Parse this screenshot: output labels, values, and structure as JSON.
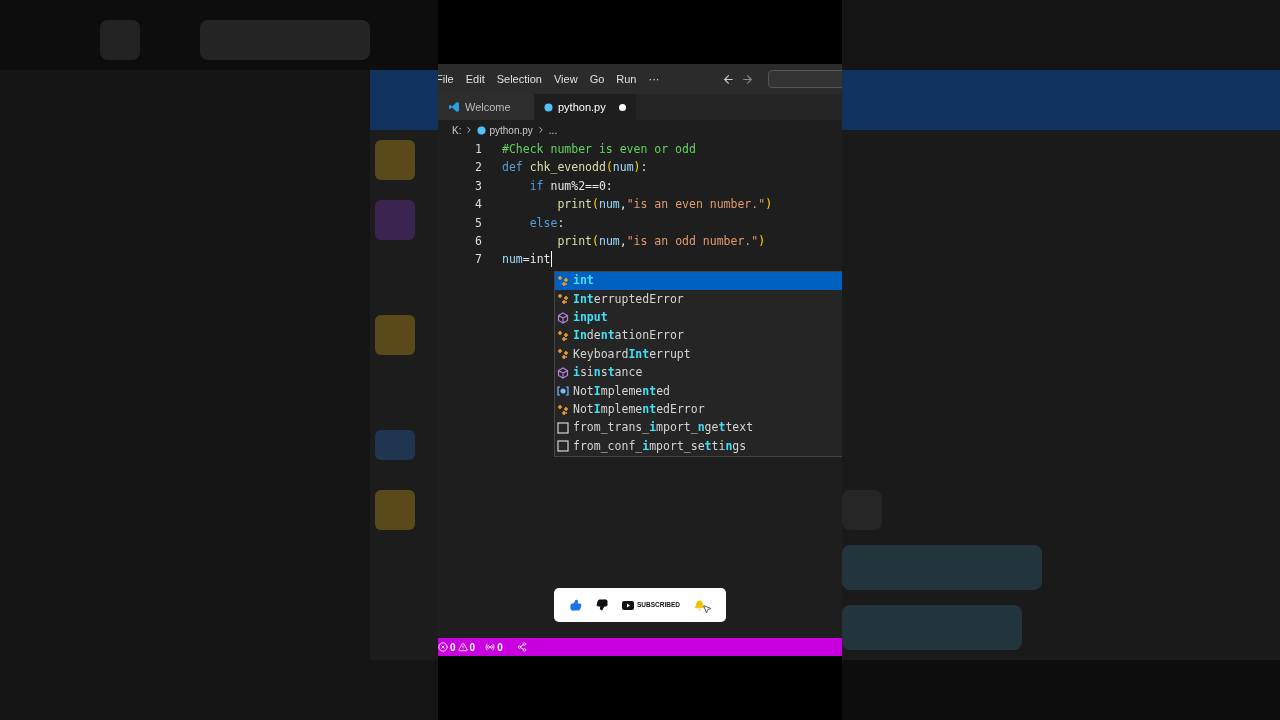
{
  "menu_bar": {
    "items": [
      "File",
      "Edit",
      "Selection",
      "View",
      "Go",
      "Run",
      "···"
    ]
  },
  "tabs": [
    {
      "label": "Welcome",
      "kind": "welcome",
      "selected": false,
      "modified": false
    },
    {
      "label": "python.py",
      "kind": "python",
      "selected": true,
      "modified": true
    }
  ],
  "breadcrumb": {
    "drive": "K:",
    "file": "python.py",
    "more": "..."
  },
  "editor": {
    "lines": [
      {
        "number": "1",
        "tokens": [
          {
            "t": "#Check number is even or odd",
            "kind": "comment"
          }
        ]
      },
      {
        "number": "2",
        "tokens": [
          {
            "t": "def",
            "kind": "keyword"
          },
          {
            "t": " chk_evenodd",
            "kind": "func"
          },
          {
            "t": "(",
            "kind": "paren"
          },
          {
            "t": "num",
            "kind": "var"
          },
          {
            "t": ")",
            "kind": "paren"
          },
          {
            "t": ":",
            "kind": "plain"
          }
        ]
      },
      {
        "number": "3",
        "tokens": [
          {
            "t": "    if",
            "kind": "keyword"
          },
          {
            "t": " num%2==0:",
            "kind": "plain"
          }
        ]
      },
      {
        "number": "4",
        "tokens": [
          {
            "t": "        print",
            "kind": "func"
          },
          {
            "t": "(",
            "kind": "paren"
          },
          {
            "t": "num",
            "kind": "var"
          },
          {
            "t": ",",
            "kind": "plain"
          },
          {
            "t": "\"is an even number.\"",
            "kind": "string"
          },
          {
            "t": ")",
            "kind": "paren"
          }
        ]
      },
      {
        "number": "5",
        "tokens": [
          {
            "t": "    else",
            "kind": "keyword"
          },
          {
            "t": ":",
            "kind": "plain"
          }
        ]
      },
      {
        "number": "6",
        "tokens": [
          {
            "t": "        print",
            "kind": "func"
          },
          {
            "t": "(",
            "kind": "paren"
          },
          {
            "t": "num",
            "kind": "var"
          },
          {
            "t": ",",
            "kind": "plain"
          },
          {
            "t": "\"is an odd number.\"",
            "kind": "string"
          },
          {
            "t": ")",
            "kind": "paren"
          }
        ]
      },
      {
        "number": "7",
        "tokens": [
          {
            "t": "num",
            "kind": "var"
          },
          {
            "t": "=",
            "kind": "plain"
          },
          {
            "t": "int",
            "kind": "plain"
          }
        ],
        "cursor": true
      }
    ]
  },
  "suggestions": [
    {
      "kind": "class",
      "selected": true,
      "parts": [
        {
          "t": "int",
          "match": true
        }
      ]
    },
    {
      "kind": "class",
      "selected": false,
      "parts": [
        {
          "t": "Int",
          "match": true
        },
        {
          "t": "erruptedError",
          "match": false
        }
      ]
    },
    {
      "kind": "function",
      "selected": false,
      "parts": [
        {
          "t": "input",
          "match": true
        }
      ]
    },
    {
      "kind": "class",
      "selected": false,
      "parts": [
        {
          "t": "In",
          "match": true
        },
        {
          "t": "de",
          "match": false
        },
        {
          "t": "nt",
          "match": true
        },
        {
          "t": "ationError",
          "match": false
        }
      ]
    },
    {
      "kind": "class",
      "selected": false,
      "parts": [
        {
          "t": "Keyboard",
          "match": false
        },
        {
          "t": "Int",
          "match": true
        },
        {
          "t": "errupt",
          "match": false
        }
      ]
    },
    {
      "kind": "function",
      "selected": false,
      "parts": [
        {
          "t": "i",
          "match": true
        },
        {
          "t": "si",
          "match": false
        },
        {
          "t": "n",
          "match": true
        },
        {
          "t": "s",
          "match": false
        },
        {
          "t": "t",
          "match": true
        },
        {
          "t": "ance",
          "match": false
        }
      ]
    },
    {
      "kind": "variable",
      "selected": false,
      "parts": [
        {
          "t": "Not",
          "match": false
        },
        {
          "t": "I",
          "match": true
        },
        {
          "t": "mpleme",
          "match": false
        },
        {
          "t": "nt",
          "match": true
        },
        {
          "t": "ed",
          "match": false
        }
      ]
    },
    {
      "kind": "class",
      "selected": false,
      "parts": [
        {
          "t": "Not",
          "match": false
        },
        {
          "t": "I",
          "match": true
        },
        {
          "t": "mpleme",
          "match": false
        },
        {
          "t": "nt",
          "match": true
        },
        {
          "t": "edError",
          "match": false
        }
      ]
    },
    {
      "kind": "snippet",
      "selected": false,
      "parts": [
        {
          "t": "from_trans_",
          "match": false
        },
        {
          "t": "i",
          "match": true
        },
        {
          "t": "mport_",
          "match": false
        },
        {
          "t": "n",
          "match": true
        },
        {
          "t": "ge",
          "match": false
        },
        {
          "t": "t",
          "match": true
        },
        {
          "t": "text",
          "match": false
        }
      ]
    },
    {
      "kind": "snippet",
      "selected": false,
      "parts": [
        {
          "t": "from_conf_",
          "match": false
        },
        {
          "t": "i",
          "match": true
        },
        {
          "t": "mport_se",
          "match": false
        },
        {
          "t": "t",
          "match": true
        },
        {
          "t": "ti",
          "match": false
        },
        {
          "t": "n",
          "match": true
        },
        {
          "t": "gs",
          "match": false
        }
      ]
    }
  ],
  "subscribe_overlay": {
    "label": "SUBSCRIBED"
  },
  "status_bar": {
    "errors": "0",
    "warnings": "0",
    "ports": "0"
  }
}
